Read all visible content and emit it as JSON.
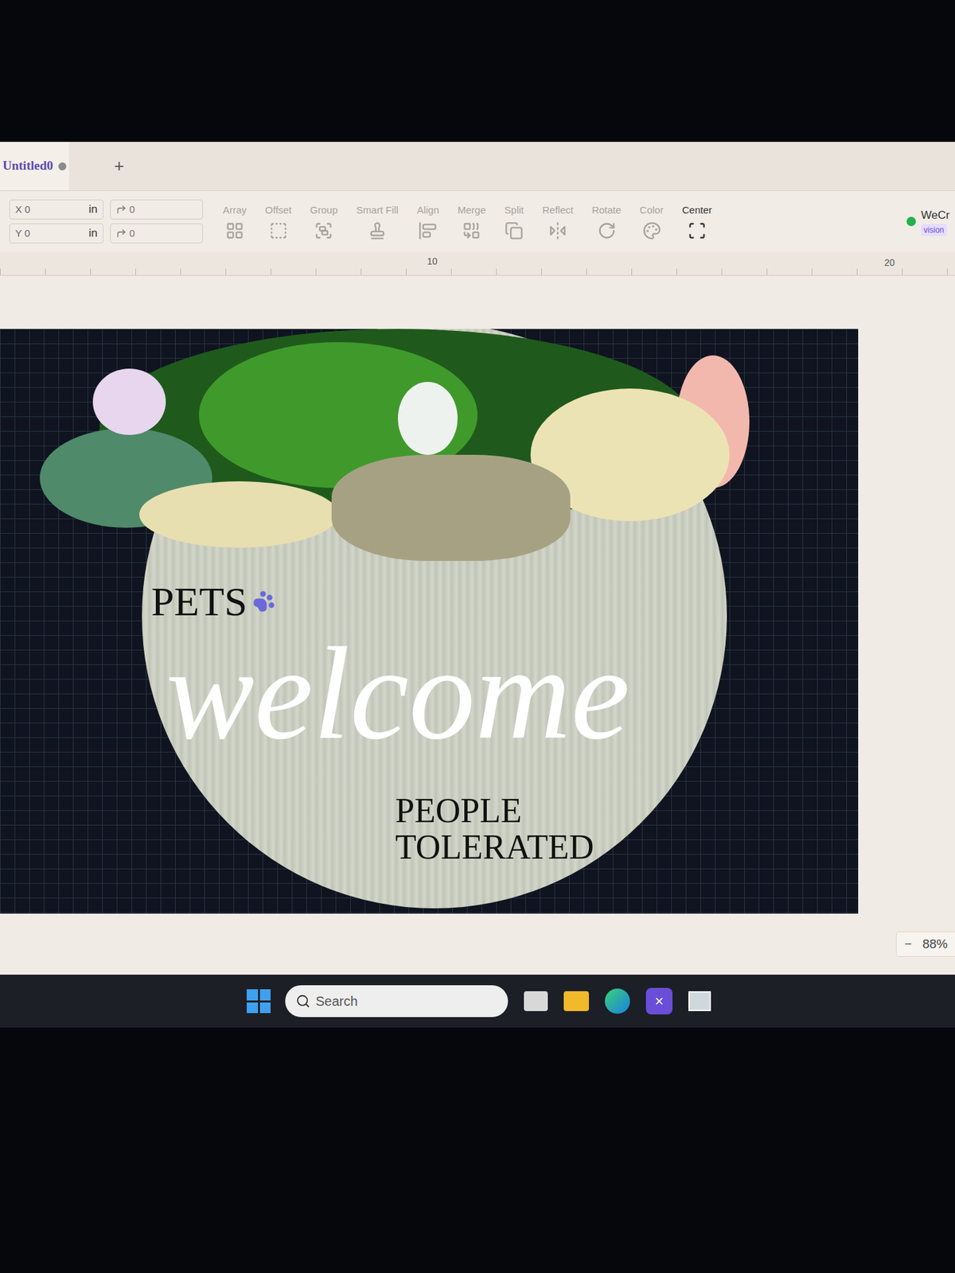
{
  "window": {
    "title": "Untitled0",
    "modified": true,
    "new_tab": "+"
  },
  "fields": [
    {
      "axis": "X",
      "value": "0",
      "unit": "in",
      "extra": "0"
    },
    {
      "axis": "Y",
      "value": "0",
      "unit": "in",
      "extra": "0"
    }
  ],
  "tools": [
    {
      "label": "Array",
      "disabled": true
    },
    {
      "label": "Offset",
      "disabled": true
    },
    {
      "label": "Group",
      "disabled": true
    },
    {
      "label": "Smart Fill",
      "disabled": true
    },
    {
      "label": "Align",
      "disabled": true
    },
    {
      "label": "Merge",
      "disabled": true
    },
    {
      "label": "Split",
      "disabled": true
    },
    {
      "label": "Reflect",
      "disabled": true
    },
    {
      "label": "Rotate",
      "disabled": true
    },
    {
      "label": "Color",
      "disabled": true
    },
    {
      "label": "Center",
      "disabled": false
    }
  ],
  "device": {
    "name": "WeCr",
    "badge": "vision",
    "connected": true
  },
  "ruler": [
    "10",
    "20"
  ],
  "design": {
    "top_text": "PETS",
    "script_text": "welcome",
    "bottom_lines": [
      "PEOPLE",
      "TOLERATED"
    ]
  },
  "zoom": {
    "minus": "−",
    "value": "88%"
  },
  "taskbar": {
    "search_placeholder": "Search"
  }
}
